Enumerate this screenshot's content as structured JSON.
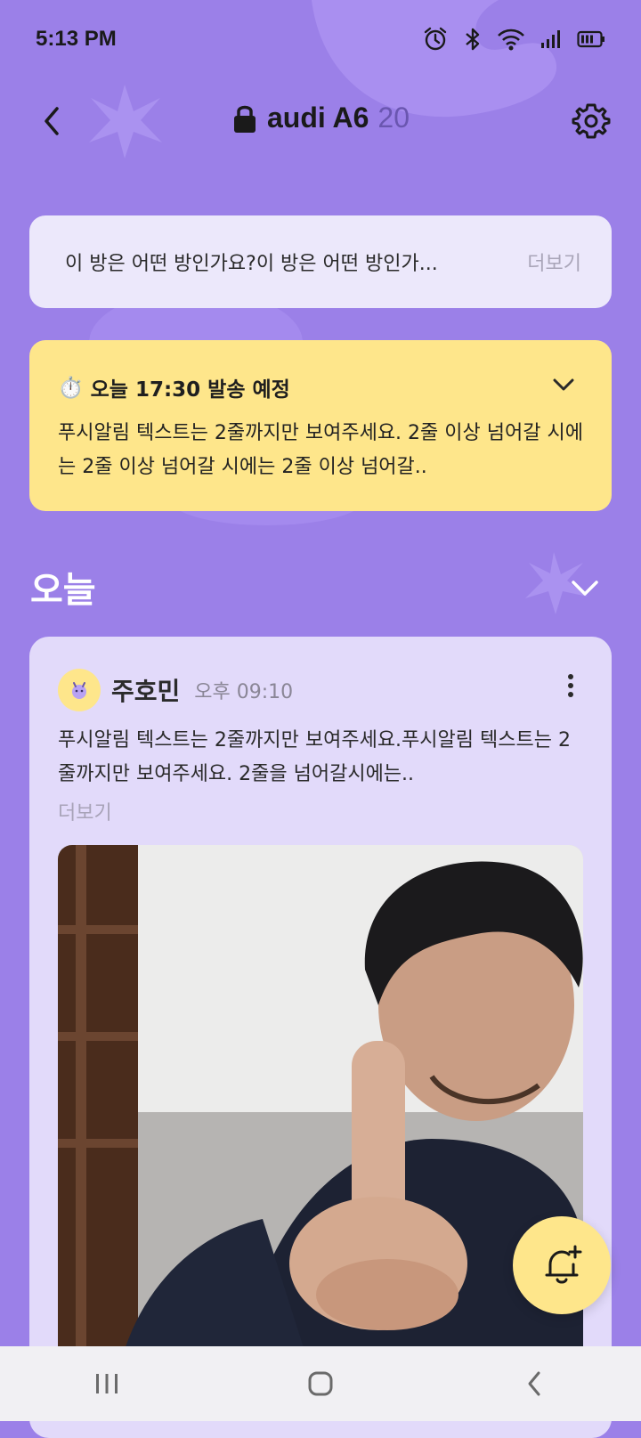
{
  "status_bar": {
    "time": "5:13 PM"
  },
  "header": {
    "title": "audi A6",
    "member_count": "20"
  },
  "room_description": {
    "text": "이 방은 어떤 방인가요?이 방은 어떤 방인가...",
    "more_label": "더보기"
  },
  "scheduled_notice": {
    "emoji": "⏱️",
    "title": "오늘 17:30 발송 예정",
    "body": "푸시알림 텍스트는 2줄까지만 보여주세요. 2줄 이상 넘어갈 시에는 2줄 이상 넘어갈 시에는 2줄 이상 넘어갈.."
  },
  "section": {
    "title": "오늘"
  },
  "post": {
    "author": "주호민",
    "time": "오후 09:10",
    "body": "푸시알림 텍스트는 2줄까지만 보여주세요.푸시알림 텍스트는 2줄까지만 보여주세요. 2줄을 넘어갈시에는..",
    "more_label": "더보기"
  },
  "colors": {
    "background": "#9b80e8",
    "card_light": "#ece8fb",
    "accent_yellow": "#fee68b",
    "post_card": "#e2dafa"
  },
  "icons": {
    "back": "back-arrow-icon",
    "lock": "lock-icon",
    "settings": "gear-icon",
    "chevron": "chevron-down-icon",
    "kebab": "more-vertical-icon",
    "fab": "bell-plus-icon"
  }
}
